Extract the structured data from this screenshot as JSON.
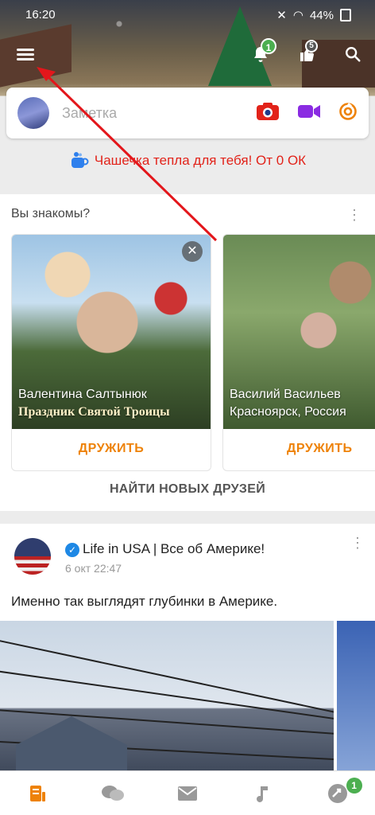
{
  "status_bar": {
    "time": "16:20",
    "battery": "44%"
  },
  "topbar": {
    "notifications_badge": "1",
    "friends_badge": "5"
  },
  "note": {
    "placeholder": "Заметка"
  },
  "promo": {
    "text": "Чашечка тепла для тебя! От 0 ОК"
  },
  "pymk": {
    "title": "Вы знакомы?",
    "people": [
      {
        "name": "Валентина Салтынюк",
        "location": "",
        "photo_overlay_text": "Праздник Святой Троицы",
        "action": "ДРУЖИТЬ"
      },
      {
        "name": "Василий Васильев",
        "location": "Красноярск, Россия",
        "action": "ДРУЖИТЬ"
      }
    ],
    "find_friends": "НАЙТИ НОВЫХ ДРУЗЕЙ"
  },
  "post": {
    "author": "Life in USA | Все об Америке!",
    "time": "6 окт 22:47",
    "text": "Именно так выглядят глубинки в Америке."
  },
  "bottom_nav": {
    "items": [
      "feed-icon",
      "discussions-icon",
      "messages-icon",
      "music-icon",
      "notifications-icon"
    ],
    "badge": "1",
    "accent": "#ee8208"
  },
  "colors": {
    "accent_orange": "#ee8208",
    "promo_red": "#e2231a",
    "verified_blue": "#1e88e5",
    "badge_green": "#4caf50"
  }
}
